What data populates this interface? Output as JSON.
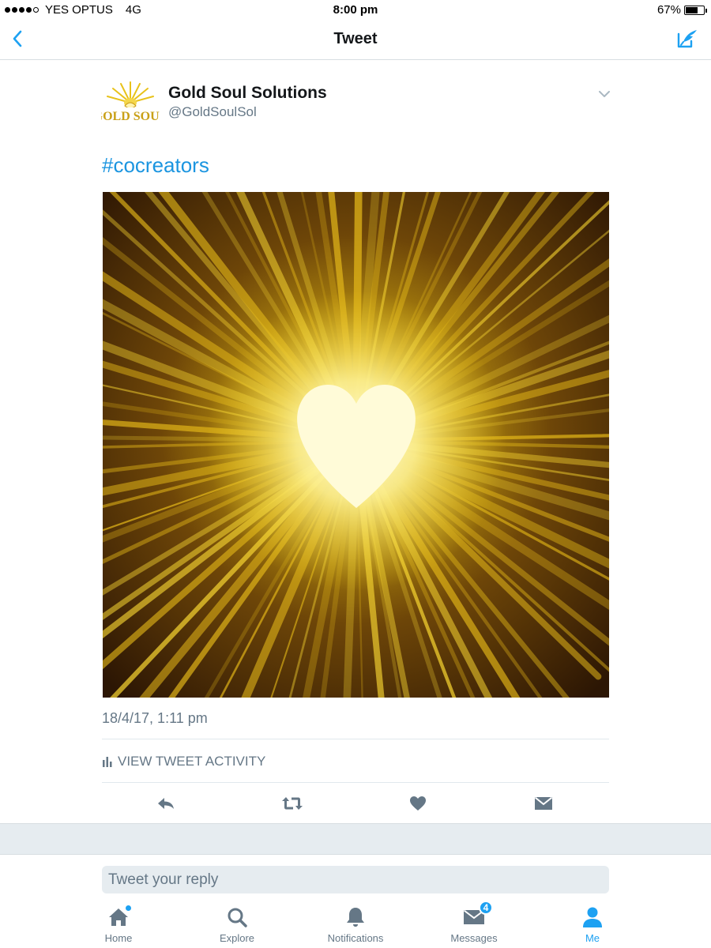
{
  "status_bar": {
    "carrier": "YES OPTUS",
    "network": "4G",
    "time": "8:00 pm",
    "battery": "67%",
    "battery_level": 0.67
  },
  "nav": {
    "title": "Tweet",
    "back_icon": "chevron-left-icon",
    "compose_icon": "compose-tweet-icon"
  },
  "tweet": {
    "author_name": "Gold Soul Solutions",
    "author_handle": "@GoldSoulSol",
    "avatar_text": "GOLD SOUL",
    "hashtag": "#cocreators",
    "timestamp": "18/4/17, 1:11 pm",
    "activity_label": "VIEW TWEET ACTIVITY"
  },
  "actions": {
    "reply": "reply-icon",
    "retweet": "retweet-icon",
    "like": "heart-icon",
    "message": "direct-message-icon"
  },
  "reply": {
    "placeholder": "Tweet your reply"
  },
  "tabs": [
    {
      "label": "Home",
      "icon": "home-icon"
    },
    {
      "label": "Explore",
      "icon": "search-icon"
    },
    {
      "label": "Notifications",
      "icon": "bell-icon"
    },
    {
      "label": "Messages",
      "icon": "envelope-icon",
      "badge": "4"
    },
    {
      "label": "Me",
      "icon": "person-icon"
    }
  ],
  "colors": {
    "accent": "#1da1f2",
    "link": "#1b95e0",
    "muted": "#657786",
    "text": "#14171a",
    "gold": "#e8c21a"
  }
}
